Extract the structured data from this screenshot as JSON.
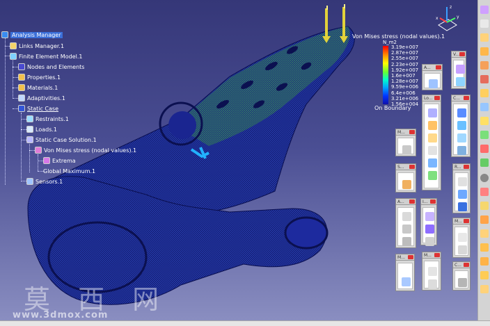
{
  "spec_tree": {
    "items": [
      {
        "label": "Analysis Manager",
        "icon": "analysis-manager-icon"
      },
      {
        "label": "Links Manager.1",
        "icon": "links-icon"
      },
      {
        "label": "Finite Element Model.1",
        "icon": "fem-icon"
      },
      {
        "label": "Nodes and Elements",
        "icon": "nodes-icon"
      },
      {
        "label": "Properties.1",
        "icon": "folder-icon"
      },
      {
        "label": "Materials.1",
        "icon": "folder-icon"
      },
      {
        "label": "Adaptivities.1",
        "icon": "adaptivity-icon"
      },
      {
        "label": "Static Case",
        "icon": "static-case-icon"
      },
      {
        "label": "Restraints.1",
        "icon": "restraint-icon"
      },
      {
        "label": "Loads.1",
        "icon": "load-icon"
      },
      {
        "label": "Static Case Solution.1",
        "icon": "solution-icon"
      },
      {
        "label": "Von Mises stress (nodal values).1",
        "icon": "image-icon"
      },
      {
        "label": "Extrema",
        "icon": "extrema-icon"
      },
      {
        "label": "Global Maximum.1",
        "icon": "global-maximum-icon"
      },
      {
        "label": "Sensors.1",
        "icon": "sensor-icon"
      }
    ]
  },
  "legend": {
    "title": "Von Mises stress (nodal values).1",
    "unit": "N_m2",
    "values": [
      "3.19e+007",
      "2.87e+007",
      "2.55e+007",
      "2.23e+007",
      "1.92e+007",
      "1.6e+007",
      "1.28e+007",
      "9.59e+006",
      "6.4e+006",
      "3.21e+006",
      "1.56e+004"
    ],
    "footer": "On Boundary"
  },
  "toolbars": [
    {
      "title": "A..."
    },
    {
      "title": "V..."
    },
    {
      "title": "Lo..."
    },
    {
      "title": "C..."
    },
    {
      "title": "M..."
    },
    {
      "title": "S..."
    },
    {
      "title": "R..."
    },
    {
      "title": "A..."
    },
    {
      "title": "I..."
    },
    {
      "title": "M..."
    },
    {
      "title": "M..."
    },
    {
      "title": "M..."
    },
    {
      "title": "C..."
    }
  ],
  "watermark": {
    "chinese": "莫 西 网",
    "url": "www.3dmox.com"
  },
  "colors": {
    "background_top": "#353778",
    "background_bottom": "#8c90c2",
    "selection": "#3b6fd8",
    "mesh": "#1a2a9a"
  }
}
